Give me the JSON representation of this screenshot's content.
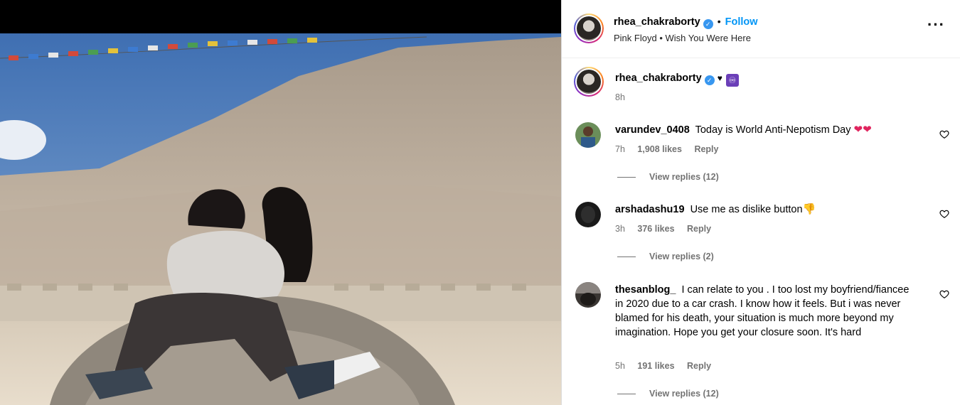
{
  "header": {
    "username": "rhea_chakraborty",
    "separator": "•",
    "follow_label": "Follow",
    "audio_artist": "Pink Floyd",
    "audio_sep": "•",
    "audio_track": "Wish You Were Here",
    "more_icon": "more-options-icon"
  },
  "caption": {
    "username": "rhea_chakraborty",
    "heart": "♥",
    "infinity": "♾",
    "time": "8h"
  },
  "comments": [
    {
      "username": "varundev_0408",
      "text": "Today is World Anti-Nepotism Day",
      "emoji": "❤❤",
      "time": "7h",
      "likes": "1,908 likes",
      "reply": "Reply",
      "view_replies": "View replies (12)"
    },
    {
      "username": "arshadashu19",
      "text": "Use me as dislike button",
      "emoji": "👎",
      "time": "3h",
      "likes": "376 likes",
      "reply": "Reply",
      "view_replies": "View replies (2)"
    },
    {
      "username": "thesanblog_",
      "text": "I can relate to you . I too lost my boyfriend/fiancee in 2020 due to a car crash. I know how it feels. But i was never blamed for his death, your situation is much more beyond my imagination. Hope you get your closure soon. It's hard",
      "emoji": "",
      "time": "5h",
      "likes": "191 likes",
      "reply": "Reply",
      "view_replies": "View replies (12)"
    }
  ],
  "colors": {
    "accent": "#0095f6",
    "verified": "#3897f0",
    "muted": "#737373"
  }
}
